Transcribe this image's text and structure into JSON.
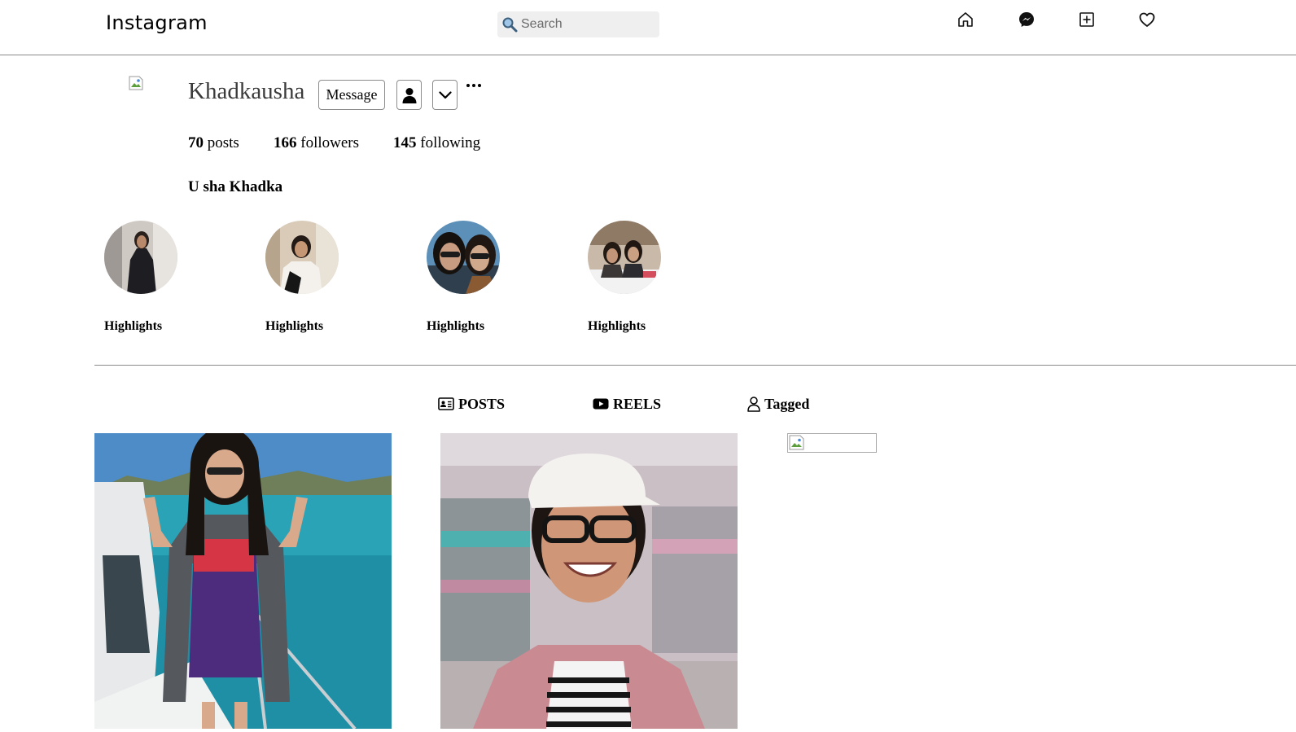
{
  "topbar": {
    "brand": "Instagram",
    "search_placeholder": "Search",
    "icons": [
      "home-icon",
      "messenger-icon",
      "new-post-icon",
      "activity-heart-icon"
    ]
  },
  "profile": {
    "username": "Khadkausha",
    "message_button": "Message",
    "follow_icon": "user-icon",
    "suggested_icon": "chevron-down-icon",
    "more_icon": "more-horizontal-icon",
    "stats": {
      "posts_count": "70",
      "posts_label": "posts",
      "followers_count": "166",
      "followers_label": "followers",
      "following_count": "145",
      "following_label": "following"
    },
    "full_name": "U sha Khadka"
  },
  "highlights": [
    {
      "label": "Highlights"
    },
    {
      "label": "Highlights"
    },
    {
      "label": "Highlights"
    },
    {
      "label": "Highlights"
    }
  ],
  "tabs": [
    {
      "label": "POSTS",
      "icon": "id-card-icon"
    },
    {
      "label": "REELS",
      "icon": "video-play-icon"
    },
    {
      "label": "Tagged",
      "icon": "person-outline-icon"
    }
  ],
  "colors": {
    "divider": "#8a8a8a",
    "search_bg": "#efefef",
    "username": "#3b3b3b"
  }
}
